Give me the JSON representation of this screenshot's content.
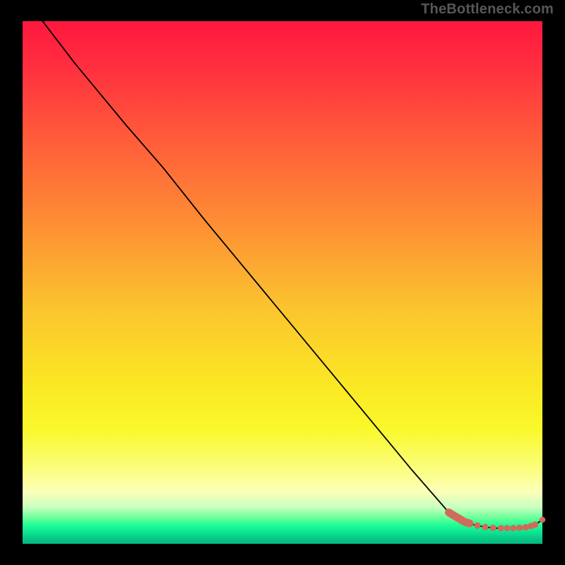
{
  "watermark": "TheBottleneck.com",
  "chart_data": {
    "type": "line",
    "title": "",
    "xlabel": "",
    "ylabel": "",
    "x": [
      0,
      10,
      20,
      27,
      35,
      45,
      55,
      65,
      75,
      82,
      85,
      87,
      89,
      91,
      93,
      95,
      97,
      98.5,
      100
    ],
    "y": [
      105,
      92,
      80,
      72,
      62,
      50,
      38,
      26,
      14,
      6,
      4.2,
      3.6,
      3.2,
      3.0,
      3.0,
      3.0,
      3.2,
      3.6,
      4.6
    ],
    "xlim": [
      0,
      100
    ],
    "ylim": [
      0,
      100
    ],
    "markers": {
      "thick_segment": {
        "x_start": 82,
        "x_end": 86
      },
      "dots_x": [
        87.5,
        89,
        90.5,
        92,
        93.2,
        94.4,
        95.6,
        96.8,
        97.8,
        98.6,
        100
      ],
      "color": "#d26a5c"
    },
    "background_gradient": {
      "stops": [
        {
          "pos": 0.0,
          "color": "#ff173e"
        },
        {
          "pos": 0.55,
          "color": "#fbc42e"
        },
        {
          "pos": 0.78,
          "color": "#faf82a"
        },
        {
          "pos": 0.96,
          "color": "#1dfc95"
        },
        {
          "pos": 1.0,
          "color": "#06b881"
        }
      ]
    }
  }
}
